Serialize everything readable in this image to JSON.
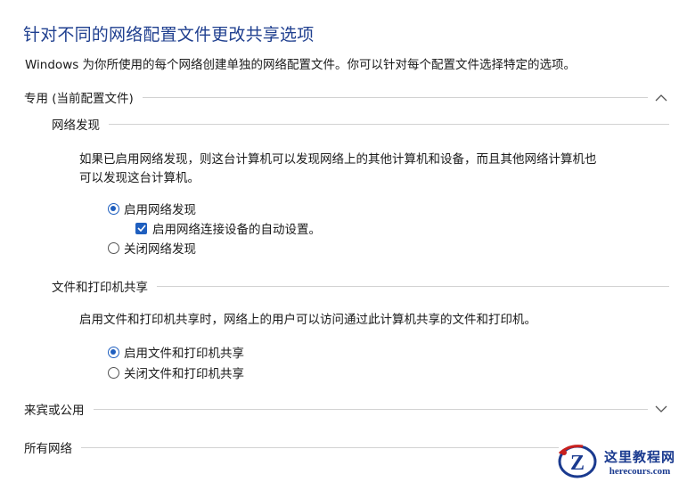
{
  "page": {
    "title": "针对不同的网络配置文件更改共享选项",
    "description": "Windows 为你所使用的每个网络创建单独的网络配置文件。你可以针对每个配置文件选择特定的选项。"
  },
  "private_profile": {
    "header": "专用 (当前配置文件)",
    "expanded": true,
    "network_discovery": {
      "label": "网络发现",
      "description_line1": "如果已启用网络发现，则这台计算机可以发现网络上的其他计算机和设备，而且其他网络计算机也",
      "description_line2": "可以发现这台计算机。",
      "option_on": "启用网络发现",
      "option_on_selected": true,
      "auto_setup": "启用网络连接设备的自动设置。",
      "auto_setup_checked": true,
      "option_off": "关闭网络发现"
    },
    "file_printer_sharing": {
      "label": "文件和打印机共享",
      "description": "启用文件和打印机共享时，网络上的用户可以访问通过此计算机共享的文件和打印机。",
      "option_on": "启用文件和打印机共享",
      "option_on_selected": true,
      "option_off": "关闭文件和打印机共享"
    }
  },
  "guest_profile": {
    "header": "来宾或公用",
    "expanded": false
  },
  "all_networks": {
    "header": "所有网络"
  },
  "watermark": {
    "logo_letter": "Z",
    "name": "这里教程网",
    "url": "herecours.com"
  },
  "colors": {
    "accent": "#1f5fbf",
    "title": "#1f3f8f",
    "rule": "#d2d2d2"
  }
}
